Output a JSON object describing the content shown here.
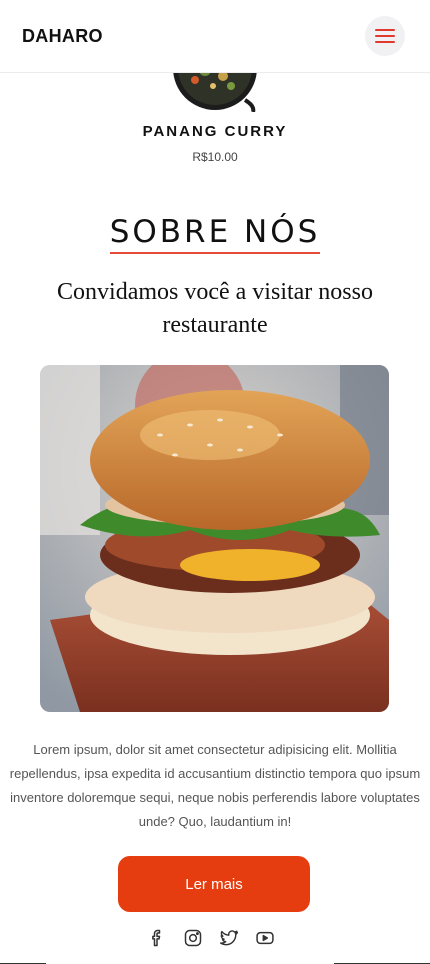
{
  "header": {
    "logo": "DAHARO",
    "menu_icon": "hamburger-icon"
  },
  "dish": {
    "name": "PANANG CURRY",
    "price": "R$10.00"
  },
  "about": {
    "title": "SOBRE NÓS",
    "subtitle": "Convidamos você a visitar nosso restaurante",
    "description": "Lorem ipsum, dolor sit amet consectetur adipisicing elit. Mollitia repellendus, ipsa expedita id accusantium distinctio tempora quo ipsum inventore doloremque sequi, neque nobis perferendis labore voluptates unde? Quo, laudantium in!",
    "button_label": "Ler mais"
  },
  "socials": [
    "facebook-icon",
    "instagram-icon",
    "twitter-icon",
    "youtube-icon"
  ],
  "colors": {
    "accent": "#e63d10",
    "underline": "#e64a3b",
    "menu_lines": "#e03a2e"
  }
}
